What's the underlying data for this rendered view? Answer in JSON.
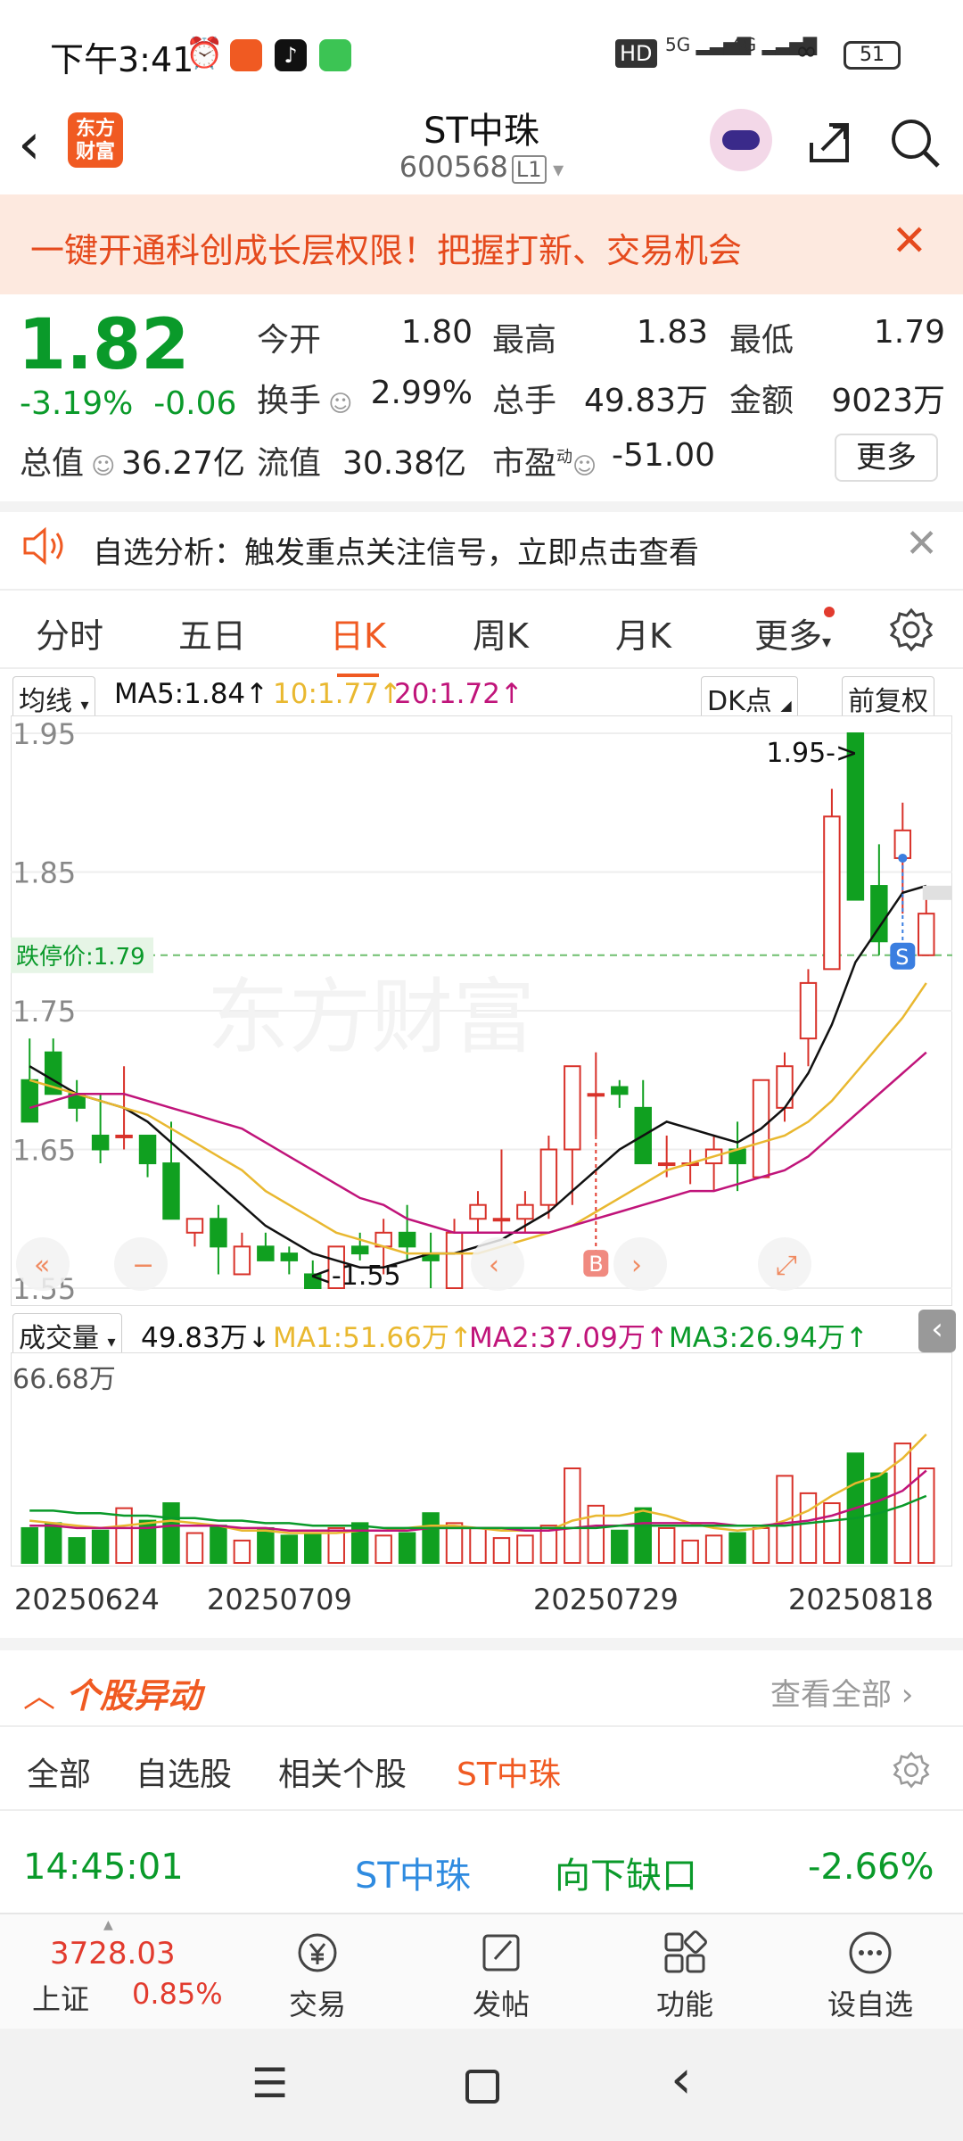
{
  "status_bar": {
    "time": "下午3:41",
    "hd_label": "HD",
    "sig1": "5G",
    "sig2": "4G",
    "battery": "51"
  },
  "header": {
    "logo_text_line1": "东方",
    "logo_text_line2": "财富",
    "stock_name": "ST中珠",
    "stock_code": "600568",
    "level": "L1"
  },
  "banner": {
    "text": "一键开通科创成长层权限！把握打新、交易机会",
    "close": "✕"
  },
  "quote": {
    "price": "1.82",
    "change_pct": "-3.19%",
    "change": "-0.06",
    "open_label": "今开",
    "open": "1.80",
    "high_label": "最高",
    "high": "1.83",
    "low_label": "最低",
    "low": "1.79",
    "turnover_label": "换手",
    "turnover": "2.99%",
    "volume_label": "总手",
    "volume": "49.83万",
    "amount_label": "金额",
    "amount": "9023万",
    "mktcap_label": "总值",
    "mktcap": "36.27亿",
    "float_label": "流值",
    "float": "30.38亿",
    "pe_label": "市盈",
    "pe_sup": "动",
    "pe": "-51.00",
    "more": "更多"
  },
  "notice": {
    "text": "自选分析：触发重点关注信号，立即点击查看",
    "close": "✕"
  },
  "tabs": [
    "分时",
    "五日",
    "日K",
    "周K",
    "月K",
    "更多"
  ],
  "active_tab": "日K",
  "indicator": {
    "ma_select": "均线",
    "ma5": "MA5:1.84",
    "ma10": "10:1.77",
    "ma20": "20:1.72",
    "dk": "DK点",
    "fq": "前复权",
    "colors": {
      "ma5": "#111111",
      "ma10": "#e9b830",
      "ma20": "#c0147a",
      "up": "#d8322a",
      "down": "#10a020"
    }
  },
  "kchart_labels": {
    "y_ticks": [
      "1.95",
      "1.85",
      "1.75",
      "1.65",
      "1.55"
    ],
    "limit_down": "跌停价:1.79",
    "max_marker": "1.95->",
    "min_marker": "<-1.55",
    "watermark": "东方财富",
    "buy_marker": "B",
    "sell_marker": "S"
  },
  "volume": {
    "select": "成交量",
    "value": "49.83万",
    "ma1": "MA1:51.66万",
    "ma2": "MA2:37.09万",
    "ma3": "MA3:26.94万",
    "max_label": "66.68万"
  },
  "x_dates": [
    "20250624",
    "20250709",
    "20250729",
    "20250818"
  ],
  "chart_data": {
    "type": "candlestick",
    "series": [
      {
        "o": 1.7,
        "h": 1.73,
        "l": 1.67,
        "c": 1.67
      },
      {
        "o": 1.72,
        "h": 1.73,
        "l": 1.69,
        "c": 1.69
      },
      {
        "o": 1.69,
        "h": 1.7,
        "l": 1.67,
        "c": 1.68
      },
      {
        "o": 1.66,
        "h": 1.69,
        "l": 1.64,
        "c": 1.65
      },
      {
        "o": 1.66,
        "h": 1.71,
        "l": 1.65,
        "c": 1.66
      },
      {
        "o": 1.66,
        "h": 1.66,
        "l": 1.63,
        "c": 1.64
      },
      {
        "o": 1.64,
        "h": 1.67,
        "l": 1.6,
        "c": 1.6
      },
      {
        "o": 1.59,
        "h": 1.6,
        "l": 1.58,
        "c": 1.6
      },
      {
        "o": 1.6,
        "h": 1.61,
        "l": 1.56,
        "c": 1.58
      },
      {
        "o": 1.56,
        "h": 1.59,
        "l": 1.56,
        "c": 1.58
      },
      {
        "o": 1.58,
        "h": 1.59,
        "l": 1.57,
        "c": 1.57
      },
      {
        "o": 1.575,
        "h": 1.58,
        "l": 1.56,
        "c": 1.57
      },
      {
        "o": 1.56,
        "h": 1.57,
        "l": 1.55,
        "c": 1.55
      },
      {
        "o": 1.55,
        "h": 1.58,
        "l": 1.55,
        "c": 1.58
      },
      {
        "o": 1.58,
        "h": 1.59,
        "l": 1.57,
        "c": 1.575
      },
      {
        "o": 1.58,
        "h": 1.6,
        "l": 1.56,
        "c": 1.59
      },
      {
        "o": 1.59,
        "h": 1.61,
        "l": 1.57,
        "c": 1.58
      },
      {
        "o": 1.575,
        "h": 1.59,
        "l": 1.55,
        "c": 1.57
      },
      {
        "o": 1.55,
        "h": 1.6,
        "l": 1.55,
        "c": 1.59
      },
      {
        "o": 1.6,
        "h": 1.62,
        "l": 1.59,
        "c": 1.61
      },
      {
        "o": 1.6,
        "h": 1.65,
        "l": 1.59,
        "c": 1.6
      },
      {
        "o": 1.6,
        "h": 1.62,
        "l": 1.59,
        "c": 1.61
      },
      {
        "o": 1.61,
        "h": 1.66,
        "l": 1.6,
        "c": 1.65
      },
      {
        "o": 1.65,
        "h": 1.71,
        "l": 1.61,
        "c": 1.71
      },
      {
        "o": 1.69,
        "h": 1.72,
        "l": 1.66,
        "c": 1.69
      },
      {
        "o": 1.695,
        "h": 1.7,
        "l": 1.68,
        "c": 1.69
      },
      {
        "o": 1.68,
        "h": 1.7,
        "l": 1.64,
        "c": 1.64
      },
      {
        "o": 1.64,
        "h": 1.66,
        "l": 1.63,
        "c": 1.64
      },
      {
        "o": 1.64,
        "h": 1.65,
        "l": 1.625,
        "c": 1.64
      },
      {
        "o": 1.64,
        "h": 1.66,
        "l": 1.62,
        "c": 1.65
      },
      {
        "o": 1.65,
        "h": 1.67,
        "l": 1.62,
        "c": 1.64
      },
      {
        "o": 1.63,
        "h": 1.7,
        "l": 1.63,
        "c": 1.7
      },
      {
        "o": 1.68,
        "h": 1.72,
        "l": 1.67,
        "c": 1.71
      },
      {
        "o": 1.73,
        "h": 1.78,
        "l": 1.71,
        "c": 1.77
      },
      {
        "o": 1.78,
        "h": 1.91,
        "l": 1.78,
        "c": 1.89
      },
      {
        "o": 1.95,
        "h": 1.95,
        "l": 1.83,
        "c": 1.83
      },
      {
        "o": 1.84,
        "h": 1.87,
        "l": 1.79,
        "c": 1.8
      },
      {
        "o": 1.86,
        "h": 1.9,
        "l": 1.82,
        "c": 1.88
      },
      {
        "o": 1.79,
        "h": 1.83,
        "l": 1.79,
        "c": 1.82
      }
    ],
    "ma5": [
      1.71,
      1.7,
      1.69,
      1.685,
      1.68,
      1.67,
      1.655,
      1.64,
      1.625,
      1.61,
      1.595,
      1.585,
      1.575,
      1.57,
      1.565,
      1.565,
      1.57,
      1.575,
      1.575,
      1.58,
      1.585,
      1.595,
      1.605,
      1.62,
      1.635,
      1.65,
      1.66,
      1.67,
      1.665,
      1.66,
      1.655,
      1.665,
      1.68,
      1.705,
      1.74,
      1.785,
      1.81,
      1.835,
      1.84
    ],
    "ma10": [
      1.7,
      1.695,
      1.69,
      1.685,
      1.68,
      1.675,
      1.665,
      1.655,
      1.645,
      1.635,
      1.62,
      1.61,
      1.6,
      1.59,
      1.585,
      1.58,
      1.575,
      1.575,
      1.575,
      1.575,
      1.58,
      1.585,
      1.59,
      1.595,
      1.605,
      1.615,
      1.625,
      1.635,
      1.64,
      1.645,
      1.65,
      1.655,
      1.66,
      1.67,
      1.685,
      1.705,
      1.725,
      1.745,
      1.77
    ],
    "ma20": [
      1.68,
      1.685,
      1.69,
      1.69,
      1.69,
      1.685,
      1.68,
      1.675,
      1.67,
      1.665,
      1.655,
      1.645,
      1.635,
      1.625,
      1.615,
      1.61,
      1.6,
      1.595,
      1.59,
      1.59,
      1.59,
      1.59,
      1.59,
      1.595,
      1.6,
      1.605,
      1.61,
      1.615,
      1.62,
      1.62,
      1.625,
      1.63,
      1.635,
      1.645,
      1.66,
      1.675,
      1.69,
      1.705,
      1.72
    ],
    "volume": [
      14,
      16,
      10,
      13,
      22,
      17,
      24,
      12,
      15,
      9,
      14,
      11,
      12,
      14,
      16,
      11,
      12,
      20,
      16,
      14,
      10,
      11,
      15,
      38,
      23,
      13,
      22,
      14,
      9,
      11,
      12,
      14,
      35,
      28,
      24,
      44,
      36,
      48,
      38
    ],
    "vol_ma1": [
      17,
      16,
      15,
      14,
      15,
      16,
      17,
      16,
      15,
      13,
      13,
      12,
      12,
      12,
      13,
      13,
      14,
      15,
      15,
      14,
      13,
      13,
      13,
      17,
      19,
      19,
      21,
      19,
      16,
      14,
      13,
      14,
      17,
      21,
      27,
      32,
      35,
      42,
      51.66
    ],
    "vol_ma2": [
      15,
      15,
      14,
      14,
      14,
      14,
      15,
      15,
      15,
      14,
      14,
      13,
      13,
      13,
      13,
      13,
      13,
      14,
      14,
      14,
      14,
      13,
      13,
      14,
      15,
      15,
      16,
      16,
      16,
      16,
      15,
      15,
      16,
      17,
      19,
      22,
      25,
      29,
      37.09
    ],
    "vol_ma3": [
      21,
      21,
      20,
      20,
      19,
      19,
      18,
      18,
      17,
      17,
      16,
      16,
      15,
      15,
      15,
      14,
      14,
      14,
      14,
      14,
      14,
      14,
      14,
      14,
      14,
      15,
      15,
      15,
      15,
      15,
      15,
      15,
      15,
      16,
      17,
      18,
      20,
      23,
      26.94
    ],
    "ylim": [
      1.55,
      1.95
    ],
    "vol_max": 66.68
  },
  "abnormal": {
    "title": "个股异动",
    "view_all": "查看全部",
    "tabs": [
      "全部",
      "自选股",
      "相关个股",
      "ST中珠"
    ],
    "active": "ST中珠",
    "row": {
      "time": "14:45:01",
      "name": "ST中珠",
      "event": "向下缺口",
      "pct": "-2.66%"
    }
  },
  "bottom_nav": {
    "index_value": "3728.03",
    "index_name": "上证",
    "index_pct": "0.85%",
    "items": [
      "交易",
      "发帖",
      "功能",
      "设自选"
    ]
  }
}
